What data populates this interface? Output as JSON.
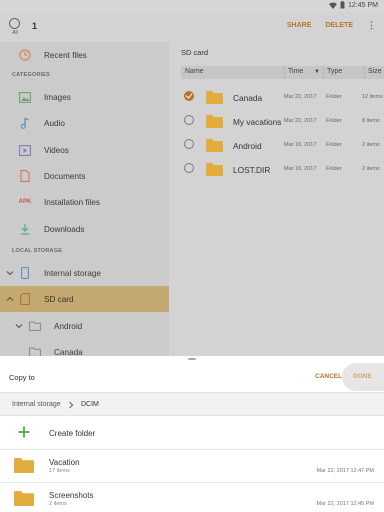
{
  "status_bar": {
    "time": "12:45 PM"
  },
  "app_bar": {
    "select_all_label": "All",
    "selected_count": "1",
    "share_label": "SHARE",
    "delete_label": "DELETE",
    "more_glyph": "⋮"
  },
  "sidebar": {
    "recent_label": "Recent files",
    "categories_header": "CATEGORIES",
    "categories": [
      {
        "label": "Images",
        "icon": "image-icon"
      },
      {
        "label": "Audio",
        "icon": "music-note-icon"
      },
      {
        "label": "Videos",
        "icon": "video-icon"
      },
      {
        "label": "Documents",
        "icon": "document-icon"
      },
      {
        "label": "Installation files",
        "icon": "apk-icon",
        "icon_text": "APK"
      },
      {
        "label": "Downloads",
        "icon": "download-icon"
      }
    ],
    "local_storage_header": "LOCAL STORAGE",
    "storage": [
      {
        "label": "Internal storage",
        "icon": "phone-icon"
      },
      {
        "label": "SD card",
        "icon": "sd-card-icon",
        "selected": true
      },
      {
        "label": "Android",
        "icon": "folder-outline-icon"
      },
      {
        "label": "Canada",
        "icon": "folder-outline-icon"
      }
    ]
  },
  "content": {
    "breadcrumb": "SD card",
    "columns": {
      "name": "Name",
      "time": "Time",
      "type": "Type",
      "size": "Size"
    },
    "files": [
      {
        "name": "Canada",
        "date": "Mar 22, 2017",
        "type": "Folder",
        "size": "12 items",
        "checked": true
      },
      {
        "name": "My vacations",
        "date": "Mar 22, 2017",
        "type": "Folder",
        "size": "8 items",
        "checked": false
      },
      {
        "name": "Android",
        "date": "Mar 16, 2017",
        "type": "Folder",
        "size": "2 items",
        "checked": false
      },
      {
        "name": "LOST.DIR",
        "date": "Mar 16, 2017",
        "type": "Folder",
        "size": "2 items",
        "checked": false
      }
    ]
  },
  "sheet": {
    "title": "Copy to",
    "cancel_label": "CANCEL",
    "done_label": "DONE",
    "path": [
      "Internal storage",
      "DCIM"
    ],
    "create_folder_label": "Create folder",
    "folders": [
      {
        "name": "Vacation",
        "items": "17 items",
        "date": "Mar 22, 2017 12:47 PM"
      },
      {
        "name": "Screenshots",
        "items": "2 items",
        "date": "Mar 22, 2017 12:45 PM"
      }
    ]
  },
  "colors": {
    "accent": "#b5752b",
    "selected_row": "#c4a871",
    "folder": "#e2ac3f",
    "create_plus": "#3aa02b"
  }
}
